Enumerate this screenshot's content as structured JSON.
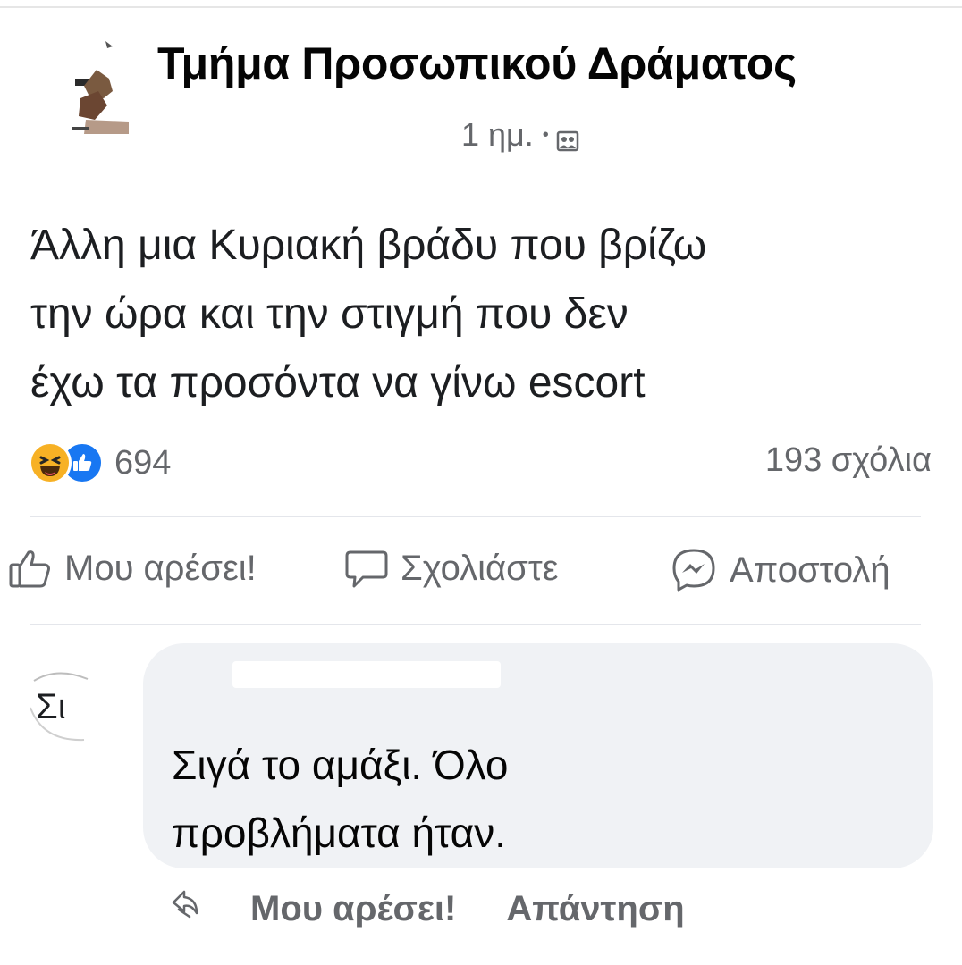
{
  "post": {
    "page_name": "Τμήμα Προσωπικού Δράματος",
    "time": "1 ημ.",
    "separator": "•",
    "audience_icon": "audience-icon",
    "text_lines": [
      "Άλλη μια Κυριακή βράδυ που βρίζω",
      "την ώρα και την στιγμή που δεν",
      "έχω τα προσόντα να γίνω escort"
    ],
    "reaction_icons": [
      "haha-icon",
      "like-icon"
    ],
    "reaction_count": "694",
    "comments_count": "193 σχόλια"
  },
  "actions": {
    "like": "Μου αρέσει!",
    "comment": "Σχολιάστε",
    "share": "Αποστολή"
  },
  "comment": {
    "avatar_text": "Σι",
    "text_lines": [
      "Σιγά το αμάξι. Όλο",
      "προβλήματα ήταν."
    ],
    "like_label": "Μου αρέσει!",
    "reply_label": "Απάντηση"
  },
  "colors": {
    "secondary_text": "#65676b",
    "like_blue": "#1877f2",
    "haha_yellow": "#f7b125",
    "bubble_bg": "#f0f2f5"
  }
}
